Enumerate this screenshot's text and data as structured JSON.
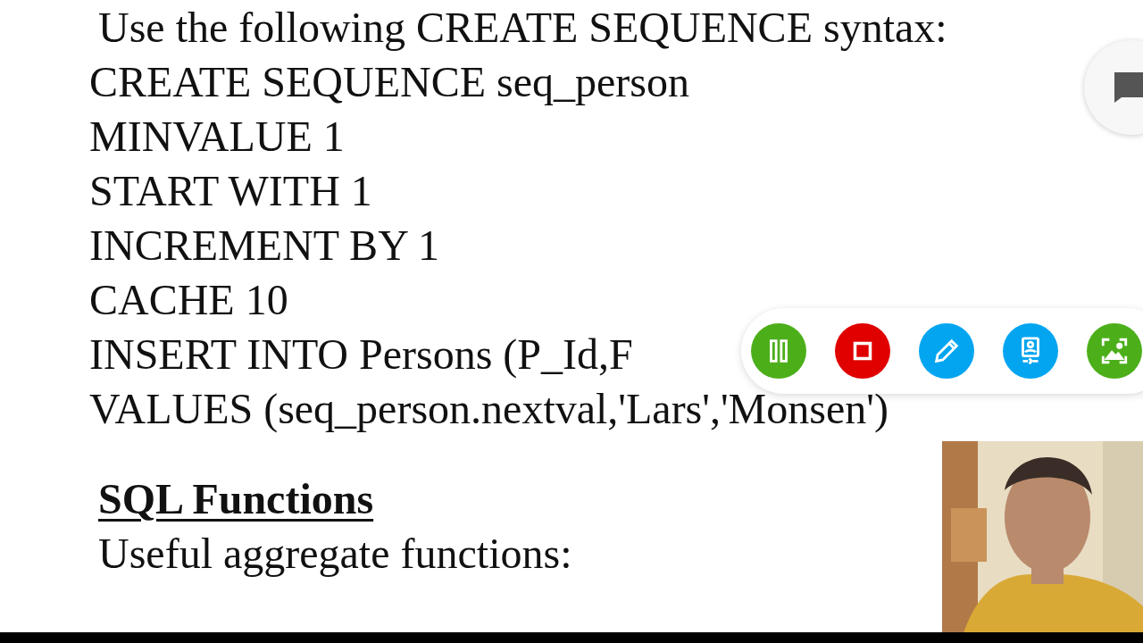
{
  "document": {
    "lines": [
      {
        "kind": "text",
        "text": "Use the following CREATE SEQUENCE syntax:"
      },
      {
        "kind": "code",
        "text": "CREATE SEQUENCE seq_person"
      },
      {
        "kind": "code",
        "text": "MINVALUE 1"
      },
      {
        "kind": "code",
        "text": "START WITH 1"
      },
      {
        "kind": "code",
        "text": "INCREMENT BY 1"
      },
      {
        "kind": "code",
        "text": "CACHE 10"
      },
      {
        "kind": "code",
        "text": "INSERT INTO Persons (P_Id,F"
      },
      {
        "kind": "code",
        "text": "VALUES (seq_person.nextval,'Lars','Monsen')"
      },
      {
        "kind": "gap"
      },
      {
        "kind": "heading",
        "text": "SQL Functions"
      },
      {
        "kind": "text",
        "text": "Useful aggregate functions:"
      }
    ]
  },
  "recorder_toolbar": {
    "buttons": [
      {
        "kind": "pause",
        "color": "#4caf1a"
      },
      {
        "kind": "stop",
        "color": "#e00000"
      },
      {
        "kind": "pen",
        "color": "#03a5f0"
      },
      {
        "kind": "facecam",
        "color": "#03a5f0"
      },
      {
        "kind": "screenshot",
        "color": "#4caf1a"
      }
    ]
  }
}
